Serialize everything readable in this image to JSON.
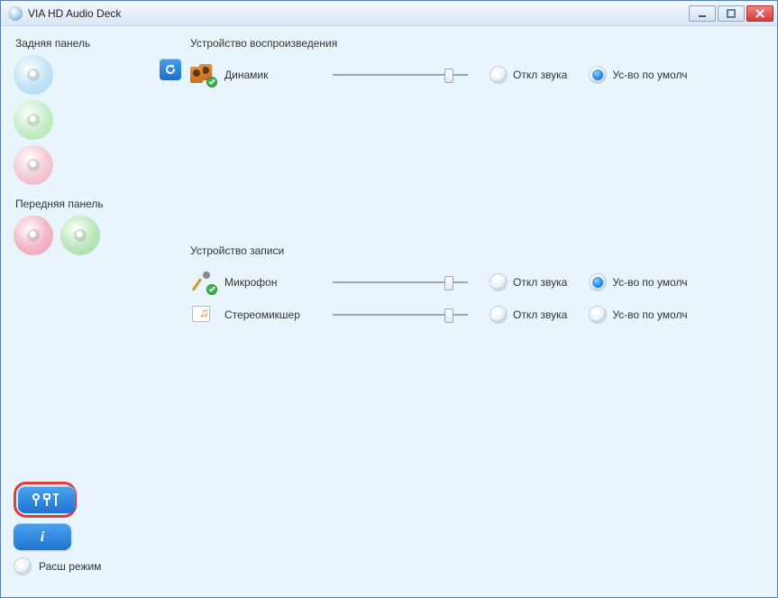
{
  "window": {
    "title": "VIA HD Audio Deck"
  },
  "sidebar": {
    "rear_panel_label": "Задняя панель",
    "front_panel_label": "Передняя панель",
    "advanced_mode_label": "Расш режим"
  },
  "main": {
    "playback_section_title": "Устройство воспроизведения",
    "recording_section_title": "Устройство записи",
    "mute_label": "Откл звука",
    "default_label": "Ус-во по умолч",
    "devices": {
      "speaker": {
        "name": "Динамик",
        "slider_pct": 86,
        "muted": false,
        "is_default": true
      },
      "microphone": {
        "name": "Микрофон",
        "slider_pct": 86,
        "muted": false,
        "is_default": true
      },
      "stereomixer": {
        "name": "Стереомикшер",
        "slider_pct": 86,
        "muted": false,
        "is_default": false
      }
    }
  }
}
